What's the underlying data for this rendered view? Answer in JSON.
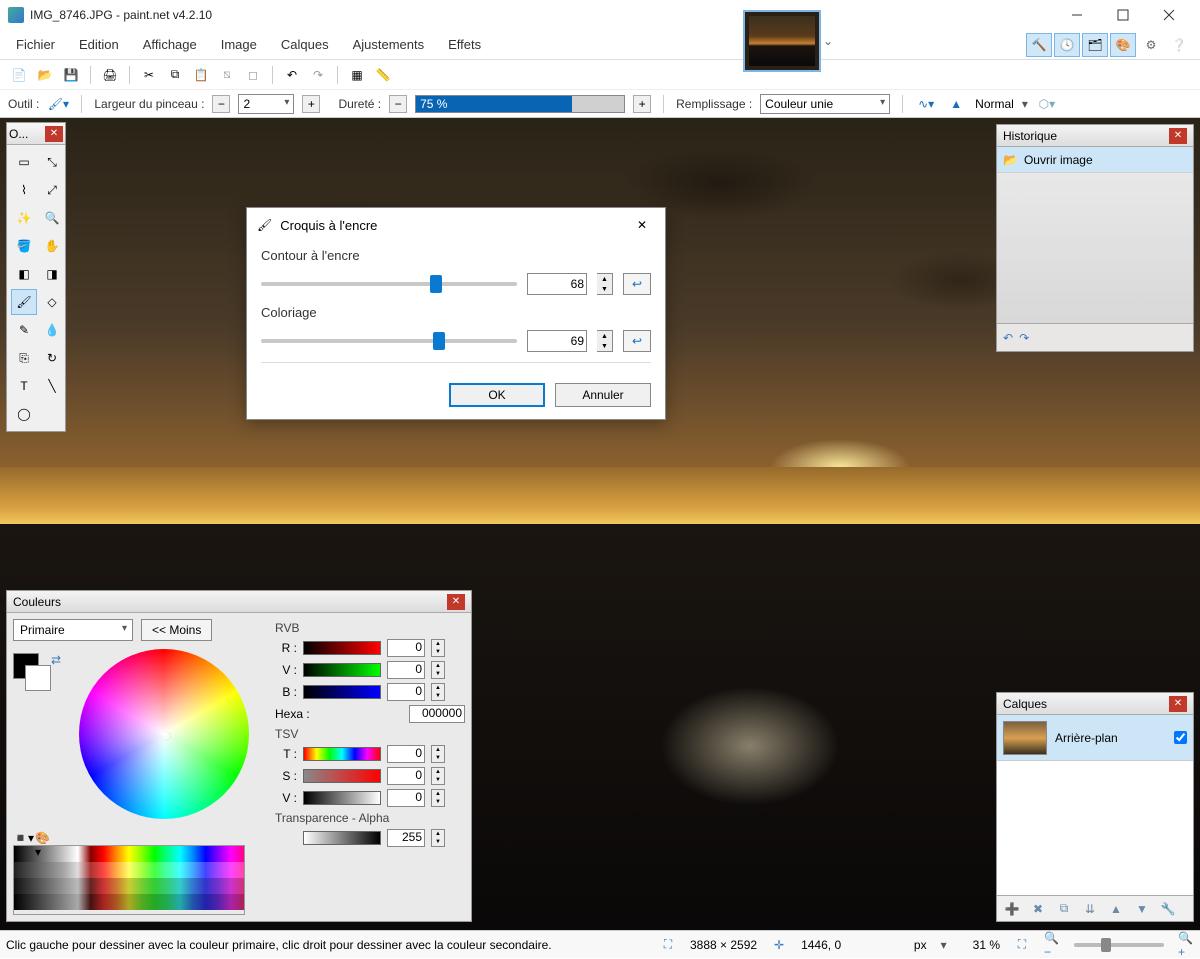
{
  "title": "IMG_8746.JPG - paint.net v4.2.10",
  "menu": [
    "Fichier",
    "Edition",
    "Affichage",
    "Image",
    "Calques",
    "Ajustements",
    "Effets"
  ],
  "options": {
    "tool_label": "Outil :",
    "brush_width_label": "Largeur du pinceau :",
    "brush_width": "2",
    "hardness_label": "Dureté :",
    "hardness": "75 %",
    "fill_label": "Remplissage :",
    "fill_value": "Couleur unie",
    "blend_value": "Normal"
  },
  "tools_panel": {
    "title": "O..."
  },
  "history": {
    "title": "Historique",
    "item": "Ouvrir image"
  },
  "layers": {
    "title": "Calques",
    "layer0": "Arrière-plan"
  },
  "colors": {
    "title": "Couleurs",
    "primary": "Primaire",
    "less": "<<  Moins",
    "rvb": "RVB",
    "r": "R :",
    "v": "V :",
    "b": "B :",
    "rv_val": "0",
    "vv_val": "0",
    "bv_val": "0",
    "hexa_label": "Hexa :",
    "hexa": "000000",
    "tsv": "TSV",
    "t": "T :",
    "s": "S :",
    "v2": "V :",
    "t_val": "0",
    "s_val": "0",
    "v2_val": "0",
    "alpha_label": "Transparence - Alpha",
    "alpha": "255"
  },
  "dialog": {
    "title": "Croquis à l'encre",
    "contour_label": "Contour à l'encre",
    "contour_val": "68",
    "color_label": "Coloriage",
    "color_val": "69",
    "ok": "OK",
    "cancel": "Annuler"
  },
  "status": {
    "msg": "Clic gauche pour dessiner avec la couleur primaire, clic droit pour dessiner avec la couleur secondaire.",
    "dims": "3888 × 2592",
    "cursor": "1446, 0",
    "unit": "px",
    "zoom": "31 %"
  }
}
